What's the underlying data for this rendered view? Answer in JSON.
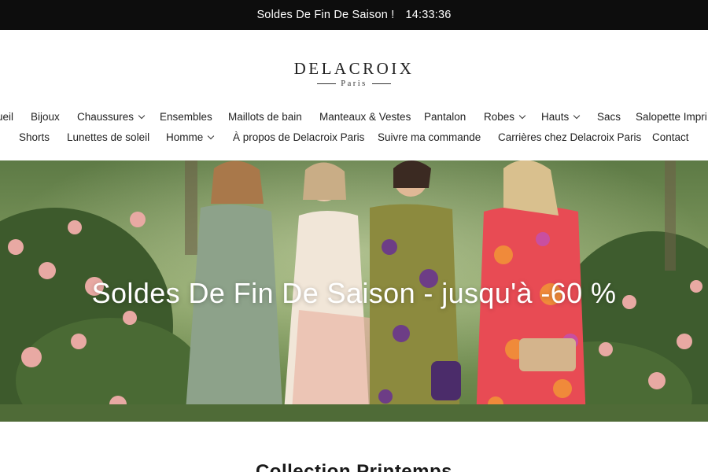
{
  "announcement": {
    "text": "Soldes De Fin De Saison !",
    "timer": "14:33:36"
  },
  "logo": {
    "brand": "DELACROIX",
    "sub": "Paris"
  },
  "nav": {
    "row1": [
      {
        "label": "ueil",
        "dropdown": false
      },
      {
        "label": "Bijoux",
        "dropdown": false
      },
      {
        "label": "Chaussures",
        "dropdown": true
      },
      {
        "label": "Ensembles",
        "dropdown": false
      },
      {
        "label": "Maillots de bain",
        "dropdown": false
      },
      {
        "label": "Manteaux & Vestes",
        "dropdown": false
      },
      {
        "label": "Pantalon",
        "dropdown": false
      },
      {
        "label": "Robes",
        "dropdown": true
      },
      {
        "label": "Hauts",
        "dropdown": true
      },
      {
        "label": "Sacs",
        "dropdown": false
      },
      {
        "label": "Salopette Impri",
        "dropdown": false
      }
    ],
    "row2": [
      {
        "label": "Shorts",
        "dropdown": false
      },
      {
        "label": "Lunettes de soleil",
        "dropdown": false
      },
      {
        "label": "Homme",
        "dropdown": true
      },
      {
        "label": "À propos de Delacroix Paris",
        "dropdown": false
      },
      {
        "label": "Suivre ma commande",
        "dropdown": false
      },
      {
        "label": "Carrières chez Delacroix Paris",
        "dropdown": false
      },
      {
        "label": "Contact",
        "dropdown": false
      }
    ]
  },
  "hero": {
    "title": "Soldes De Fin De Saison - jusqu'à -60 %"
  },
  "section": {
    "title": "Collection Printemps"
  },
  "colors": {
    "announcement_bg": "#0d0d0d",
    "text": "#1f1f1f",
    "hero_overlay_text": "#ffffff"
  }
}
